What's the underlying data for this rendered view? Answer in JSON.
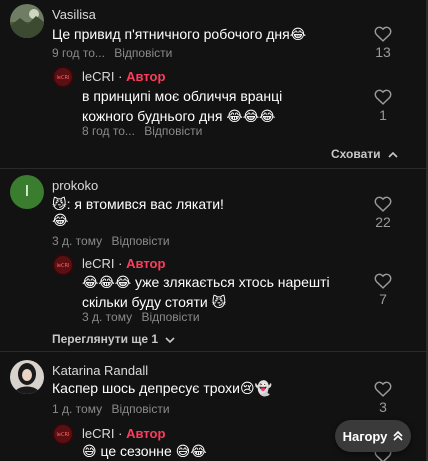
{
  "colors": {
    "background": "#121212",
    "author_badge": "#ff3b5c",
    "muted": "#8a8a8a",
    "floating_button": "#3a3a3a"
  },
  "comments": [
    {
      "author": "Vasilisa",
      "text": "Це привид п'ятничного робочого дня😂",
      "time": "9 год то...",
      "reply_label": "Відповісти",
      "likes": "13",
      "avatar": "photo-landscape",
      "replies": [
        {
          "author": "leCRI",
          "author_tag": "Автор",
          "separator": "·",
          "text": "в принципі моє обличчя вранці кожного буднього дня 😂😂😂",
          "time": "8 год то...",
          "reply_label": "Відповісти",
          "likes": "1",
          "avatar": "logo-dark-red"
        }
      ],
      "collapse_label": "Сховати",
      "collapse_icon": "chevron-up-icon"
    },
    {
      "author": "prokoko",
      "text": "😼: я втомився вас лякати!",
      "text2": "😂",
      "time": "3 д. тому",
      "reply_label": "Відповісти",
      "likes": "22",
      "avatar_letter": "I",
      "avatar_color": "#3b7d2e",
      "replies": [
        {
          "author": "leCRI",
          "author_tag": "Автор",
          "separator": "·",
          "text": "😂😂😂 уже злякається хтось нарешті скільки буду стояти 😼",
          "time": "3 д. тому",
          "reply_label": "Відповісти",
          "likes": "7",
          "avatar": "logo-dark-red"
        }
      ],
      "more_replies_label": "Переглянути ще 1",
      "more_icon": "chevron-down-icon"
    },
    {
      "author": "Katarina Randall",
      "text": "Каспер шось депресує трохи😢👻",
      "time": "1 д. тому",
      "reply_label": "Відповісти",
      "likes": "3",
      "avatar": "photo-portrait",
      "replies": [
        {
          "author": "leCRI",
          "author_tag": "Автор",
          "separator": "·",
          "text": "😅 це сезонне 😅😂",
          "avatar": "logo-dark-red"
        }
      ]
    }
  ],
  "floating_button": {
    "label": "Нагору",
    "icon": "double-chevron-up-icon"
  }
}
